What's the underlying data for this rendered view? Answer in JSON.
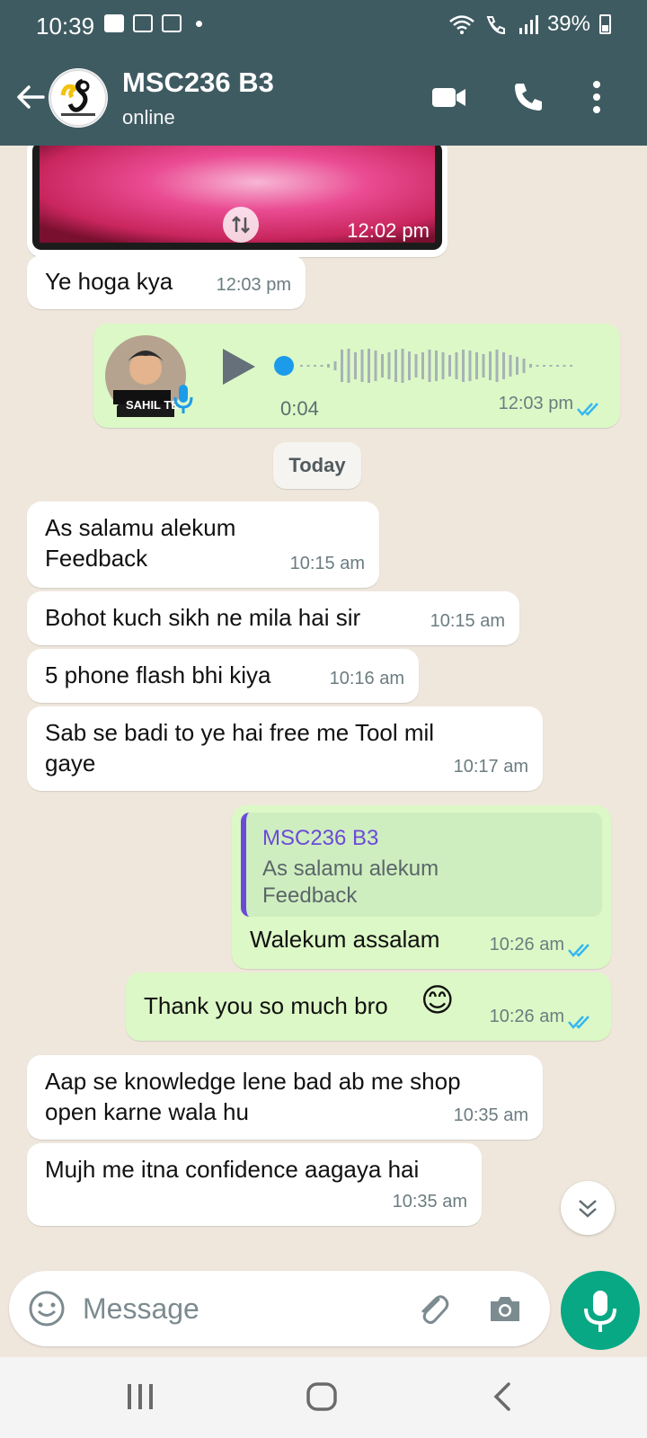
{
  "status": {
    "time": "10:39",
    "battery": "39%"
  },
  "header": {
    "title": "MSC236 B3",
    "subtitle": "online"
  },
  "messages": {
    "image_time": "12:02 pm",
    "m1": {
      "text": "Ye hoga kya",
      "time": "12:03 pm"
    },
    "voice": {
      "duration": "0:04",
      "time": "12:03 pm",
      "avatar_text": "SAHIL TE"
    },
    "date_divider": "Today",
    "m2": {
      "text": "As salamu alekum\nFeedback",
      "time": "10:15 am"
    },
    "m3": {
      "text": "Bohot kuch sikh ne mila hai sir",
      "time": "10:15 am"
    },
    "m4": {
      "text": "5 phone flash bhi kiya",
      "time": "10:16 am"
    },
    "m5": {
      "text": "Sab se badi to ye hai free me Tool mil\ngaye",
      "time": "10:17 am"
    },
    "m6": {
      "quote_name": "MSC236 B3",
      "quote_text": "As salamu alekum\nFeedback",
      "text": "Walekum assalam",
      "time": "10:26 am"
    },
    "m7": {
      "text": "Thank you so much bro",
      "emoji": "😊",
      "time": "10:26 am"
    },
    "m8": {
      "text": "Aap se knowledge lene bad ab me shop\nopen karne wala hu",
      "time": "10:35 am"
    },
    "m9": {
      "text": "Mujh me itna confidence aagaya hai",
      "time": "10:35 am"
    }
  },
  "composer": {
    "placeholder": "Message"
  },
  "colors": {
    "header": "#3f5b62",
    "outgoing": "#dcf8c6",
    "incoming": "#ffffff",
    "accent": "#08a884",
    "read_ticks": "#34b7f1"
  }
}
